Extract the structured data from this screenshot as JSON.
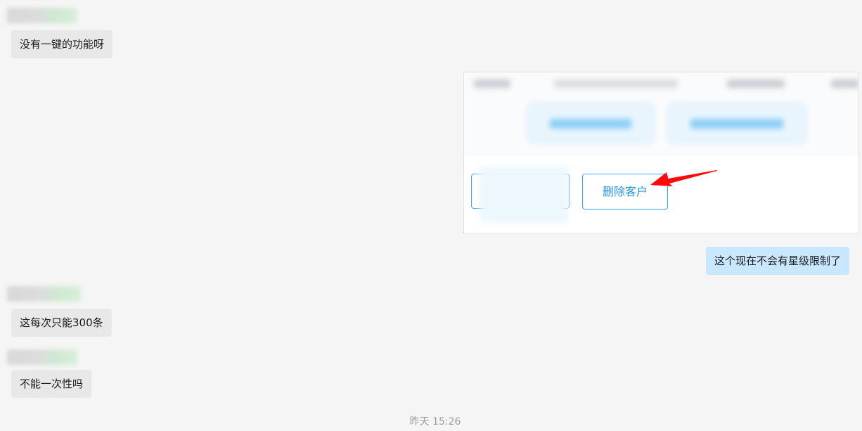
{
  "messages": [
    {
      "side": "left",
      "text": "没有一键的功能呀"
    },
    {
      "side": "right",
      "type": "image",
      "button_label": "删除客户"
    },
    {
      "side": "right",
      "text": "这个现在不会有星级限制了"
    },
    {
      "side": "left",
      "text": "这每次只能300条"
    },
    {
      "side": "left",
      "text": "不能一次性吗"
    }
  ],
  "timestamp": "昨天 15:26",
  "colors": {
    "background": "#f5f5f5",
    "left_bubble": "#e8e8e8",
    "right_bubble": "#c9e7ff",
    "annotation_arrow": "#ff0000",
    "button_border": "#35a8ec"
  }
}
